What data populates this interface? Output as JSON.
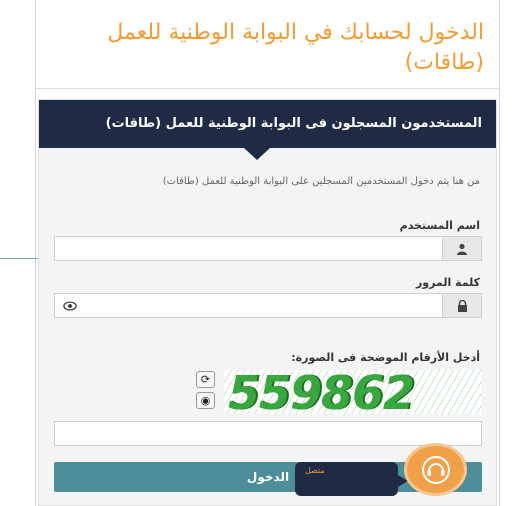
{
  "page": {
    "title": "الدخول لحسابك في البوابة الوطنية للعمل (طاقات)"
  },
  "panel": {
    "header": "المستخدمون المسجلون فى البوابة الوطنية للعمل (طاقات)",
    "description": "من هنا يتم دخول المستخدمين المسجلين على البوابة الوطنية للعمل (طاقات)"
  },
  "form": {
    "username_label": "اسم المستخدم",
    "username_value": "",
    "password_label": "كلمة المرور",
    "password_value": "",
    "captcha_label": "أدخل الأرقام الموضحة فى الصورة:",
    "captcha_value": "559862",
    "captcha_input_value": "",
    "submit_label": "الدخول"
  },
  "chat": {
    "status": "متصل"
  },
  "icons": {
    "username": "user-icon",
    "password": "lock-icon",
    "show_password": "eye-icon",
    "refresh_captcha": "refresh-icon",
    "audio_captcha": "audio-icon",
    "chat": "headset-icon"
  },
  "colors": {
    "title": "#f39c33",
    "header": "#1f2a44",
    "button": "#4d8e99",
    "chat": "#f1a04a"
  }
}
